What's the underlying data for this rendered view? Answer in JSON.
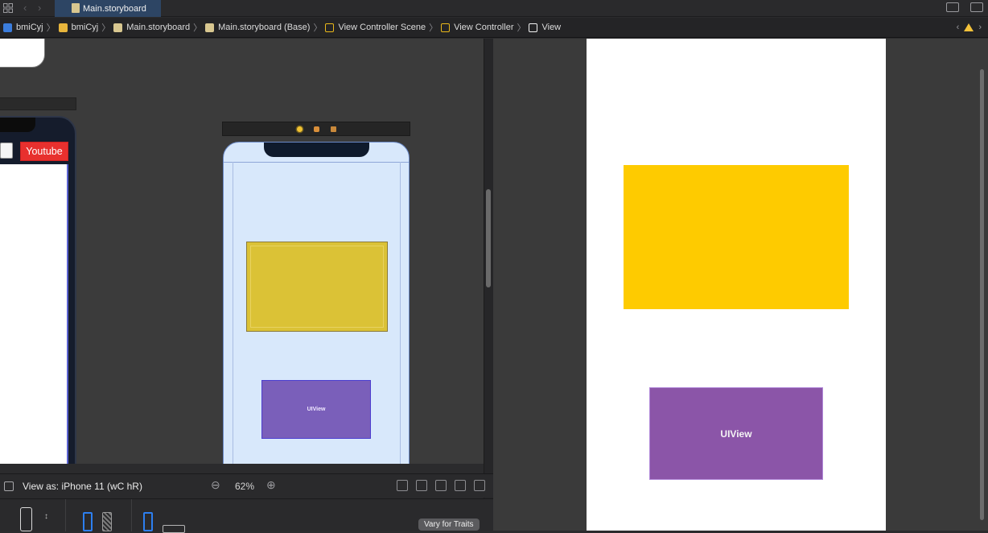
{
  "tabbar": {
    "active_tab": "Main.storyboard"
  },
  "breadcrumb": {
    "items": [
      {
        "label": "bmiCyj",
        "icon": "project-icon"
      },
      {
        "label": "bmiCyj",
        "icon": "folder-icon"
      },
      {
        "label": "Main.storyboard",
        "icon": "storyboard-icon"
      },
      {
        "label": "Main.storyboard (Base)",
        "icon": "storyboard-icon"
      },
      {
        "label": "View Controller Scene",
        "icon": "scene-icon"
      },
      {
        "label": "View Controller",
        "icon": "view-controller-icon"
      },
      {
        "label": "View",
        "icon": "view-icon"
      }
    ]
  },
  "canvas": {
    "prev_scene_button": "Youtube",
    "current_scene_purple_label": "UIView"
  },
  "bottom_bar": {
    "view_as": "View as: iPhone 11 (wC hR)",
    "zoom": "62%",
    "vary_button": "Vary for Traits"
  },
  "preview": {
    "purple_label": "UIView",
    "colors": {
      "yellow": "#fecb00",
      "purple": "#8b55a8"
    }
  }
}
